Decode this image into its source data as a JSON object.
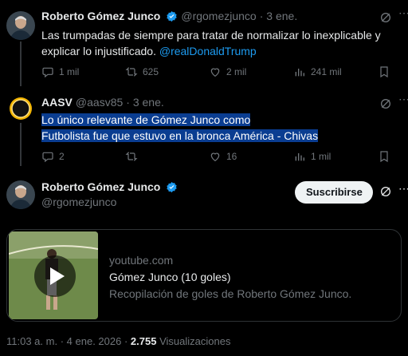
{
  "tweet1": {
    "name": "Roberto Gómez Junco",
    "handle": "@rgomezjunco",
    "date": "· 3 ene.",
    "text": "Las trumpadas de siempre para tratar de normalizar lo inexplicable y explicar lo injustificado.",
    "mention": "@realDonaldTrump",
    "replies": "1 mil",
    "retweets": "625",
    "likes": "2 mil",
    "views": "241 mil"
  },
  "tweet2": {
    "name": "AASV",
    "handle": "@aasv85",
    "date": "· 3 ene.",
    "line1": "Lo único relevante de Gómez Junco como",
    "line2": "Futbolista fue que estuvo en la bronca América - Chivas",
    "replies": "2",
    "likes": "16",
    "views": "1 mil"
  },
  "main": {
    "name": "Roberto Gómez Junco",
    "handle": "@rgomezjunco",
    "subscribe_label": "Suscribirse",
    "card": {
      "domain": "youtube.com",
      "title": "Gómez Junco (10 goles)",
      "description": "Recopilación de goles de Roberto Gómez Junco."
    },
    "time": "11:03 a. m.",
    "date": "4 ene. 2026",
    "views_count": "2.755",
    "views_label": "Visualizaciones"
  },
  "colors": {
    "background": "#000000",
    "accent": "#1d9bf0",
    "muted": "#71767b",
    "highlight": "#0a3d91"
  }
}
